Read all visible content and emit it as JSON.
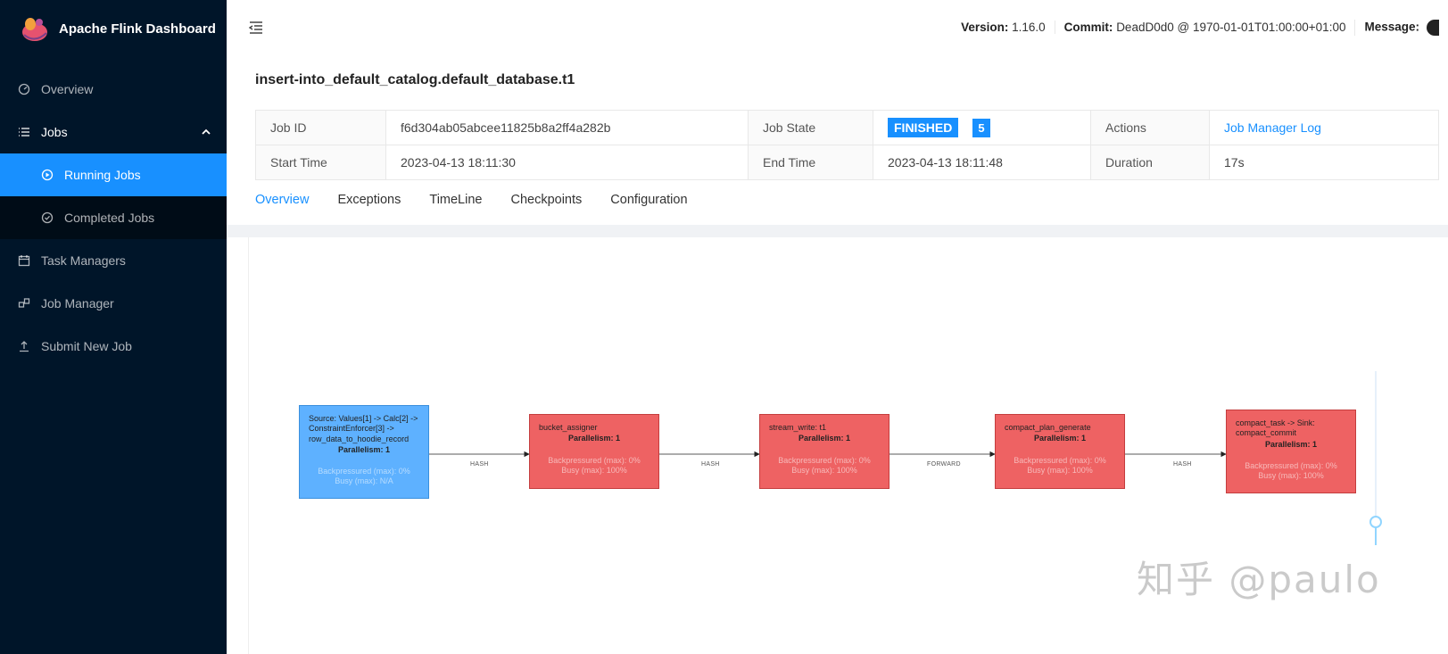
{
  "app": {
    "title": "Apache Flink Dashboard"
  },
  "sidebar": {
    "items": [
      {
        "label": "Overview",
        "icon": "dashboard-icon"
      },
      {
        "label": "Jobs",
        "icon": "list-icon"
      },
      {
        "label": "Running Jobs",
        "icon": "play-circle-icon"
      },
      {
        "label": "Completed Jobs",
        "icon": "check-circle-icon"
      },
      {
        "label": "Task Managers",
        "icon": "schedule-icon"
      },
      {
        "label": "Job Manager",
        "icon": "cluster-icon"
      },
      {
        "label": "Submit New Job",
        "icon": "upload-icon"
      }
    ]
  },
  "header": {
    "version_label": "Version:",
    "version_value": "1.16.0",
    "commit_label": "Commit:",
    "commit_value": "DeadD0d0 @ 1970-01-01T01:00:00+01:00",
    "message_label": "Message:"
  },
  "job": {
    "title": "insert-into_default_catalog.default_database.t1",
    "id_label": "Job ID",
    "id_value": "f6d304ab05abcee11825b8a2ff4a282b",
    "state_label": "Job State",
    "state_value": "FINISHED",
    "state_count": "5",
    "actions_label": "Actions",
    "actions_link": "Job Manager Log",
    "start_label": "Start Time",
    "start_value": "2023-04-13 18:11:30",
    "end_label": "End Time",
    "end_value": "2023-04-13 18:11:48",
    "duration_label": "Duration",
    "duration_value": "17s"
  },
  "tabs": [
    "Overview",
    "Exceptions",
    "TimeLine",
    "Checkpoints",
    "Configuration"
  ],
  "graph": {
    "nodes": [
      {
        "name": "Source: Values[1] -> Calc[2] -> ConstraintEnforcer[3] -> row_data_to_hoodie_record",
        "parallelism": "Parallelism: 1",
        "backpressure": "Backpressured (max): 0%",
        "busy": "Busy (max): N/A",
        "color": "#5eb1ff"
      },
      {
        "name": "bucket_assigner",
        "parallelism": "Parallelism: 1",
        "backpressure": "Backpressured (max): 0%",
        "busy": "Busy (max): 100%",
        "color": "#ee6263"
      },
      {
        "name": "stream_write: t1",
        "parallelism": "Parallelism: 1",
        "backpressure": "Backpressured (max): 0%",
        "busy": "Busy (max): 100%",
        "color": "#ee6263"
      },
      {
        "name": "compact_plan_generate",
        "parallelism": "Parallelism: 1",
        "backpressure": "Backpressured (max): 0%",
        "busy": "Busy (max): 100%",
        "color": "#ee6263"
      },
      {
        "name": "compact_task -> Sink: compact_commit",
        "parallelism": "Parallelism: 1",
        "backpressure": "Backpressured (max): 0%",
        "busy": "Busy (max): 100%",
        "color": "#ee6263"
      }
    ],
    "edges": [
      "HASH",
      "HASH",
      "FORWARD",
      "HASH"
    ]
  },
  "watermark": "知乎 @paulo"
}
